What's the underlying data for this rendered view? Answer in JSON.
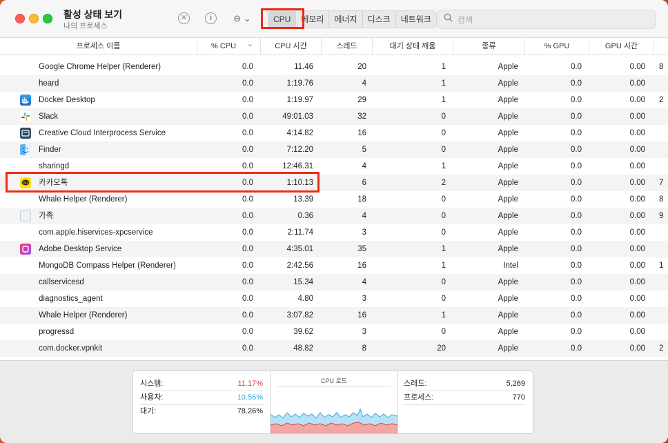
{
  "window": {
    "title": "활성 상태 보기",
    "subtitle": "나의 프로세스"
  },
  "toolbar": {
    "tabs": [
      "CPU",
      "메모리",
      "에너지",
      "디스크",
      "네트워크"
    ],
    "active_tab": "CPU",
    "search_placeholder": "검색"
  },
  "columns": [
    "프로세스 이름",
    "% CPU",
    "CPU 시간",
    "스레드",
    "대기 상태 깨움",
    "종류",
    "% GPU",
    "GPU 시간"
  ],
  "processes": [
    {
      "name": "Google Chrome Helper (Renderer)",
      "icon": "none",
      "cpu": "0.0",
      "cpu_time": "11.46",
      "threads": "20",
      "wakeups": "1",
      "kind": "Apple",
      "gpu": "0.0",
      "gpu_time": "0.00",
      "extra": "8"
    },
    {
      "name": "heard",
      "icon": "none",
      "cpu": "0.0",
      "cpu_time": "1:19.76",
      "threads": "4",
      "wakeups": "1",
      "kind": "Apple",
      "gpu": "0.0",
      "gpu_time": "0.00",
      "extra": ""
    },
    {
      "name": "Docker Desktop",
      "icon": "docker-icon",
      "cpu": "0.0",
      "cpu_time": "1:19.97",
      "threads": "29",
      "wakeups": "1",
      "kind": "Apple",
      "gpu": "0.0",
      "gpu_time": "0.00",
      "extra": "2"
    },
    {
      "name": "Slack",
      "icon": "slack-icon",
      "cpu": "0.0",
      "cpu_time": "49:01.03",
      "threads": "32",
      "wakeups": "0",
      "kind": "Apple",
      "gpu": "0.0",
      "gpu_time": "0.00",
      "extra": ""
    },
    {
      "name": "Creative Cloud Interprocess Service",
      "icon": "creative-cloud-icon",
      "cpu": "0.0",
      "cpu_time": "4:14.82",
      "threads": "16",
      "wakeups": "0",
      "kind": "Apple",
      "gpu": "0.0",
      "gpu_time": "0.00",
      "extra": ""
    },
    {
      "name": "Finder",
      "icon": "finder-icon",
      "cpu": "0.0",
      "cpu_time": "7:12.20",
      "threads": "5",
      "wakeups": "0",
      "kind": "Apple",
      "gpu": "0.0",
      "gpu_time": "0.00",
      "extra": ""
    },
    {
      "name": "sharingd",
      "icon": "none",
      "cpu": "0.0",
      "cpu_time": "12:46.31",
      "threads": "4",
      "wakeups": "1",
      "kind": "Apple",
      "gpu": "0.0",
      "gpu_time": "0.00",
      "extra": ""
    },
    {
      "name": "카카오톡",
      "icon": "kakaotalk-icon",
      "cpu": "0.0",
      "cpu_time": "1:10.13",
      "threads": "6",
      "wakeups": "2",
      "kind": "Apple",
      "gpu": "0.0",
      "gpu_time": "0.00",
      "extra": "7"
    },
    {
      "name": "Whale Helper (Renderer)",
      "icon": "none",
      "cpu": "0.0",
      "cpu_time": "13.39",
      "threads": "18",
      "wakeups": "0",
      "kind": "Apple",
      "gpu": "0.0",
      "gpu_time": "0.00",
      "extra": "8"
    },
    {
      "name": "가족",
      "icon": "generic-app-icon",
      "cpu": "0.0",
      "cpu_time": "0.36",
      "threads": "4",
      "wakeups": "0",
      "kind": "Apple",
      "gpu": "0.0",
      "gpu_time": "0.00",
      "extra": "9"
    },
    {
      "name": "com.apple.hiservices-xpcservice",
      "icon": "none",
      "cpu": "0.0",
      "cpu_time": "2:11.74",
      "threads": "3",
      "wakeups": "0",
      "kind": "Apple",
      "gpu": "0.0",
      "gpu_time": "0.00",
      "extra": ""
    },
    {
      "name": "Adobe Desktop Service",
      "icon": "adobe-icon",
      "cpu": "0.0",
      "cpu_time": "4:35.01",
      "threads": "35",
      "wakeups": "1",
      "kind": "Apple",
      "gpu": "0.0",
      "gpu_time": "0.00",
      "extra": ""
    },
    {
      "name": "MongoDB Compass Helper (Renderer)",
      "icon": "none",
      "cpu": "0.0",
      "cpu_time": "2:42.56",
      "threads": "16",
      "wakeups": "1",
      "kind": "Intel",
      "gpu": "0.0",
      "gpu_time": "0.00",
      "extra": "1"
    },
    {
      "name": "callservicesd",
      "icon": "none",
      "cpu": "0.0",
      "cpu_time": "15.34",
      "threads": "4",
      "wakeups": "0",
      "kind": "Apple",
      "gpu": "0.0",
      "gpu_time": "0.00",
      "extra": ""
    },
    {
      "name": "diagnostics_agent",
      "icon": "none",
      "cpu": "0.0",
      "cpu_time": "4.80",
      "threads": "3",
      "wakeups": "0",
      "kind": "Apple",
      "gpu": "0.0",
      "gpu_time": "0.00",
      "extra": ""
    },
    {
      "name": "Whale Helper (Renderer)",
      "icon": "none",
      "cpu": "0.0",
      "cpu_time": "3:07.82",
      "threads": "16",
      "wakeups": "1",
      "kind": "Apple",
      "gpu": "0.0",
      "gpu_time": "0.00",
      "extra": ""
    },
    {
      "name": "progressd",
      "icon": "none",
      "cpu": "0.0",
      "cpu_time": "39.62",
      "threads": "3",
      "wakeups": "0",
      "kind": "Apple",
      "gpu": "0.0",
      "gpu_time": "0.00",
      "extra": ""
    },
    {
      "name": "com.docker.vpnkit",
      "icon": "none",
      "cpu": "0.0",
      "cpu_time": "48.82",
      "threads": "8",
      "wakeups": "20",
      "kind": "Apple",
      "gpu": "0.0",
      "gpu_time": "0.00",
      "extra": "2"
    }
  ],
  "summary": {
    "system_label": "시스템:",
    "system_value": "11.17%",
    "user_label": "사용자:",
    "user_value": "10.56%",
    "idle_label": "대기:",
    "idle_value": "78.26%",
    "chart_title": "CPU 로드",
    "threads_label": "스레드:",
    "threads_value": "5,269",
    "processes_label": "프로세스:",
    "processes_value": "770"
  },
  "colors": {
    "system": "#e0413a",
    "user": "#38a8dc",
    "highlight": "#ef2a12"
  }
}
